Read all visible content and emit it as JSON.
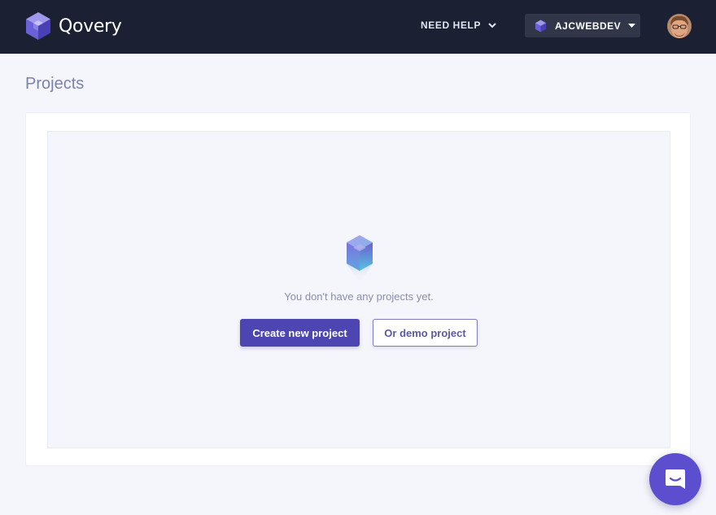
{
  "header": {
    "brand": "Qovery",
    "help_label": "NEED HELP",
    "org_name": "AJCWEBDEV"
  },
  "page": {
    "title": "Projects"
  },
  "empty_state": {
    "message": "You don't have any projects yet.",
    "create_label": "Create new project",
    "demo_label": "Or demo project"
  },
  "colors": {
    "topbar": "#1b2032",
    "accent": "#4d46b2",
    "chat": "#5b4fd0",
    "page_bg": "#f5f6fb"
  },
  "icons": {
    "brand": "qovery-cube-icon",
    "help_dropdown": "chevron-down-icon",
    "org": "qovery-cube-icon",
    "org_dropdown": "caret-down-icon",
    "empty": "hexagon-cube-icon",
    "chat": "chat-smile-icon"
  }
}
